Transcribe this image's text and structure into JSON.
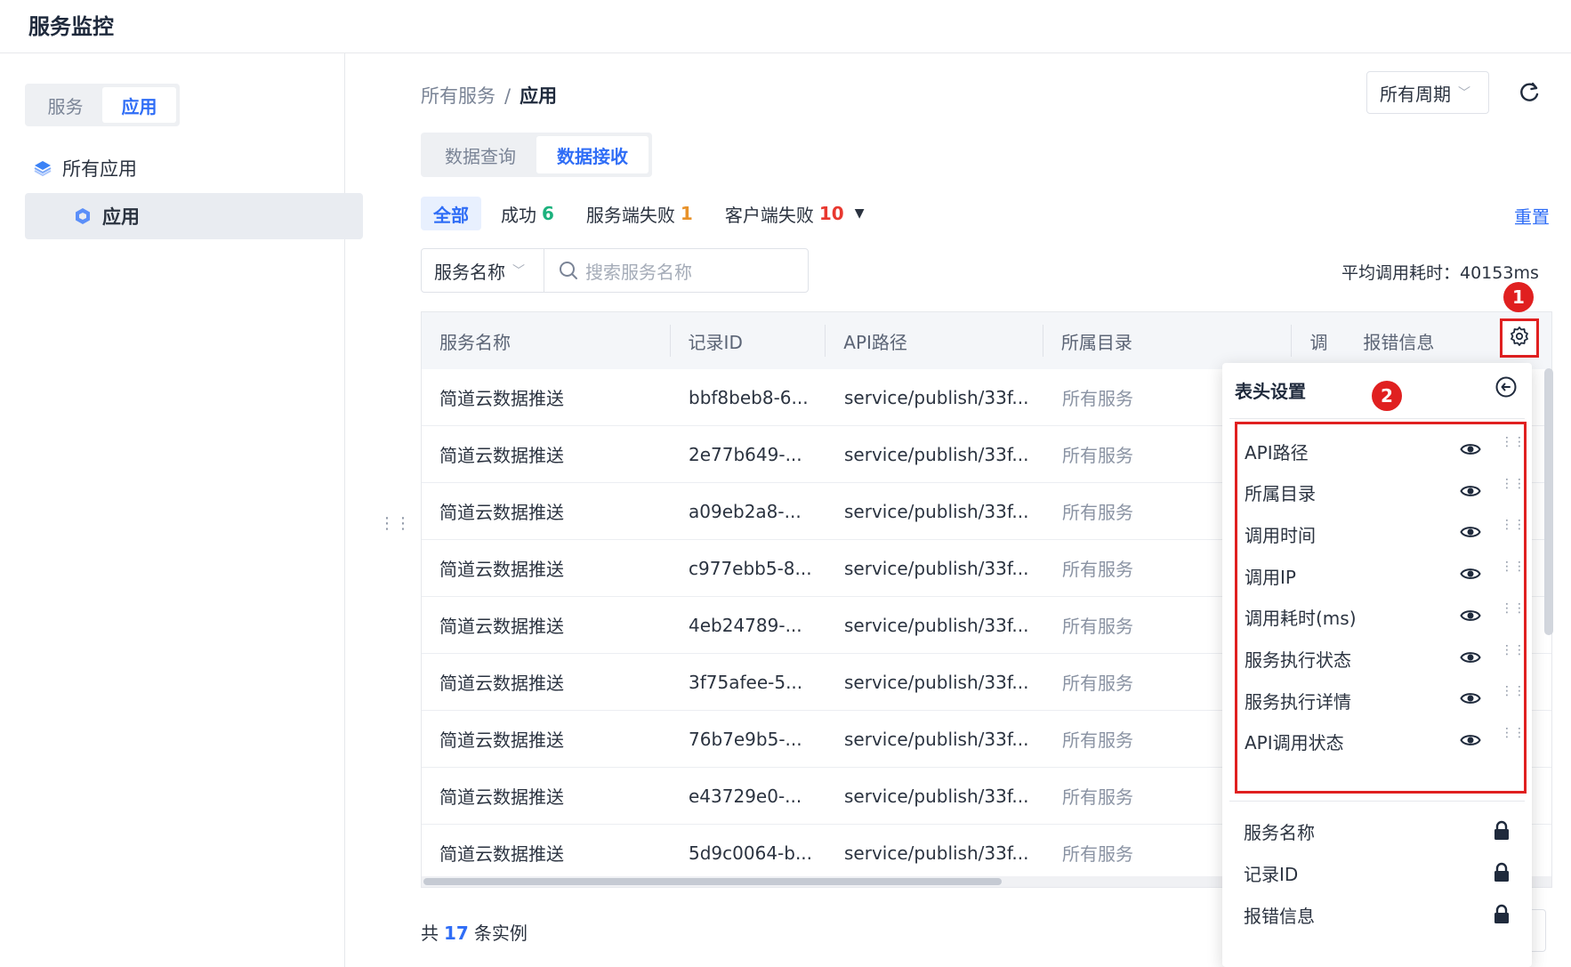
{
  "app": {
    "title": "服务监控"
  },
  "sidebar": {
    "segments": [
      {
        "label": "服务",
        "active": false
      },
      {
        "label": "应用",
        "active": true
      }
    ],
    "tree_root": "所有应用",
    "tree_child": "应用"
  },
  "breadcrumb": {
    "root": "所有服务",
    "separator": "/",
    "current": "应用"
  },
  "period_select": {
    "value": "所有周期"
  },
  "tabs": [
    {
      "label": "数据查询",
      "active": false
    },
    {
      "label": "数据接收",
      "active": true
    }
  ],
  "filters": {
    "all": "全部",
    "success": {
      "label": "成功",
      "count": "6"
    },
    "server_fail": {
      "label": "服务端失败",
      "count": "1"
    },
    "client_fail": {
      "label": "客户端失败",
      "count": "10"
    },
    "reset": "重置"
  },
  "search": {
    "field": "服务名称",
    "placeholder": "搜索服务名称"
  },
  "avg_time": "平均调用耗时：40153ms",
  "table": {
    "headers": [
      "服务名称",
      "记录ID",
      "API路径",
      "所属目录",
      "调",
      "报错信息"
    ],
    "rows": [
      [
        "简道云数据推送",
        "bbf8beb8-6...",
        "service/publish/33f...",
        "所有服务"
      ],
      [
        "简道云数据推送",
        "2e77b649-...",
        "service/publish/33f...",
        "所有服务"
      ],
      [
        "简道云数据推送",
        "a09eb2a8-...",
        "service/publish/33f...",
        "所有服务"
      ],
      [
        "简道云数据推送",
        "c977ebb5-8...",
        "service/publish/33f...",
        "所有服务"
      ],
      [
        "简道云数据推送",
        "4eb24789-...",
        "service/publish/33f...",
        "所有服务"
      ],
      [
        "简道云数据推送",
        "3f75afee-5...",
        "service/publish/33f...",
        "所有服务"
      ],
      [
        "简道云数据推送",
        "76b7e9b5-...",
        "service/publish/33f...",
        "所有服务"
      ],
      [
        "简道云数据推送",
        "e43729e0-...",
        "service/publish/33f...",
        "所有服务"
      ],
      [
        "简道云数据推送",
        "5d9c0064-b...",
        "service/publish/33f...",
        "所有服务"
      ]
    ]
  },
  "footer": {
    "prefix": "共",
    "total": "17",
    "suffix": "条实例"
  },
  "badges": {
    "one": "1",
    "two": "2"
  },
  "column_panel": {
    "title": "表头设置",
    "visible_columns": [
      "API路径",
      "所属目录",
      "调用时间",
      "调用IP",
      "调用耗时(ms)",
      "服务执行状态",
      "服务执行详情",
      "API调用状态"
    ],
    "locked_columns": [
      "服务名称",
      "记录ID",
      "报错信息"
    ]
  },
  "colors": {
    "accent": "#2f6df6",
    "highlight": "#e02020",
    "success": "#1cb17d",
    "warning": "#e8922a",
    "danger": "#e8382f"
  }
}
